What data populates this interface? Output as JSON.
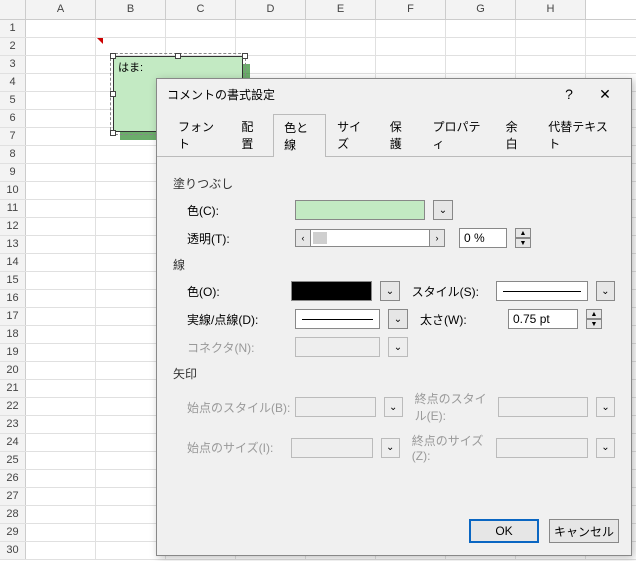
{
  "sheet": {
    "columns": [
      "A",
      "B",
      "C",
      "D",
      "E",
      "F",
      "G",
      "H"
    ],
    "rows": [
      "1",
      "2",
      "3",
      "4",
      "5",
      "6",
      "7",
      "8",
      "9",
      "10",
      "11",
      "12",
      "13",
      "14",
      "15",
      "16",
      "17",
      "18",
      "19",
      "20",
      "21",
      "22",
      "23",
      "24",
      "25",
      "26",
      "27",
      "28",
      "29",
      "30"
    ]
  },
  "comment_text": "はま:",
  "dialog": {
    "title": "コメントの書式設定",
    "help_label": "?",
    "close_label": "✕",
    "tabs": [
      "フォント",
      "配置",
      "色と線",
      "サイズ",
      "保護",
      "プロパティ",
      "余白",
      "代替テキスト"
    ],
    "active_tab": 2,
    "fill": {
      "group": "塗りつぶし",
      "color_label": "色(C):",
      "fill_color": "#c3eac3",
      "transparency_label": "透明(T):",
      "transparency_value": "0 %"
    },
    "line": {
      "group": "線",
      "color_label": "色(O):",
      "line_color": "#000000",
      "dash_label": "実線/点線(D):",
      "connector_label": "コネクタ(N):",
      "style_label": "スタイル(S):",
      "weight_label": "太さ(W):",
      "weight_value": "0.75 pt"
    },
    "arrow": {
      "group": "矢印",
      "begin_style_label": "始点のスタイル(B):",
      "begin_size_label": "始点のサイズ(I):",
      "end_style_label": "終点のスタイル(E):",
      "end_size_label": "終点のサイズ(Z):"
    },
    "buttons": {
      "ok": "OK",
      "cancel": "キャンセル"
    }
  }
}
